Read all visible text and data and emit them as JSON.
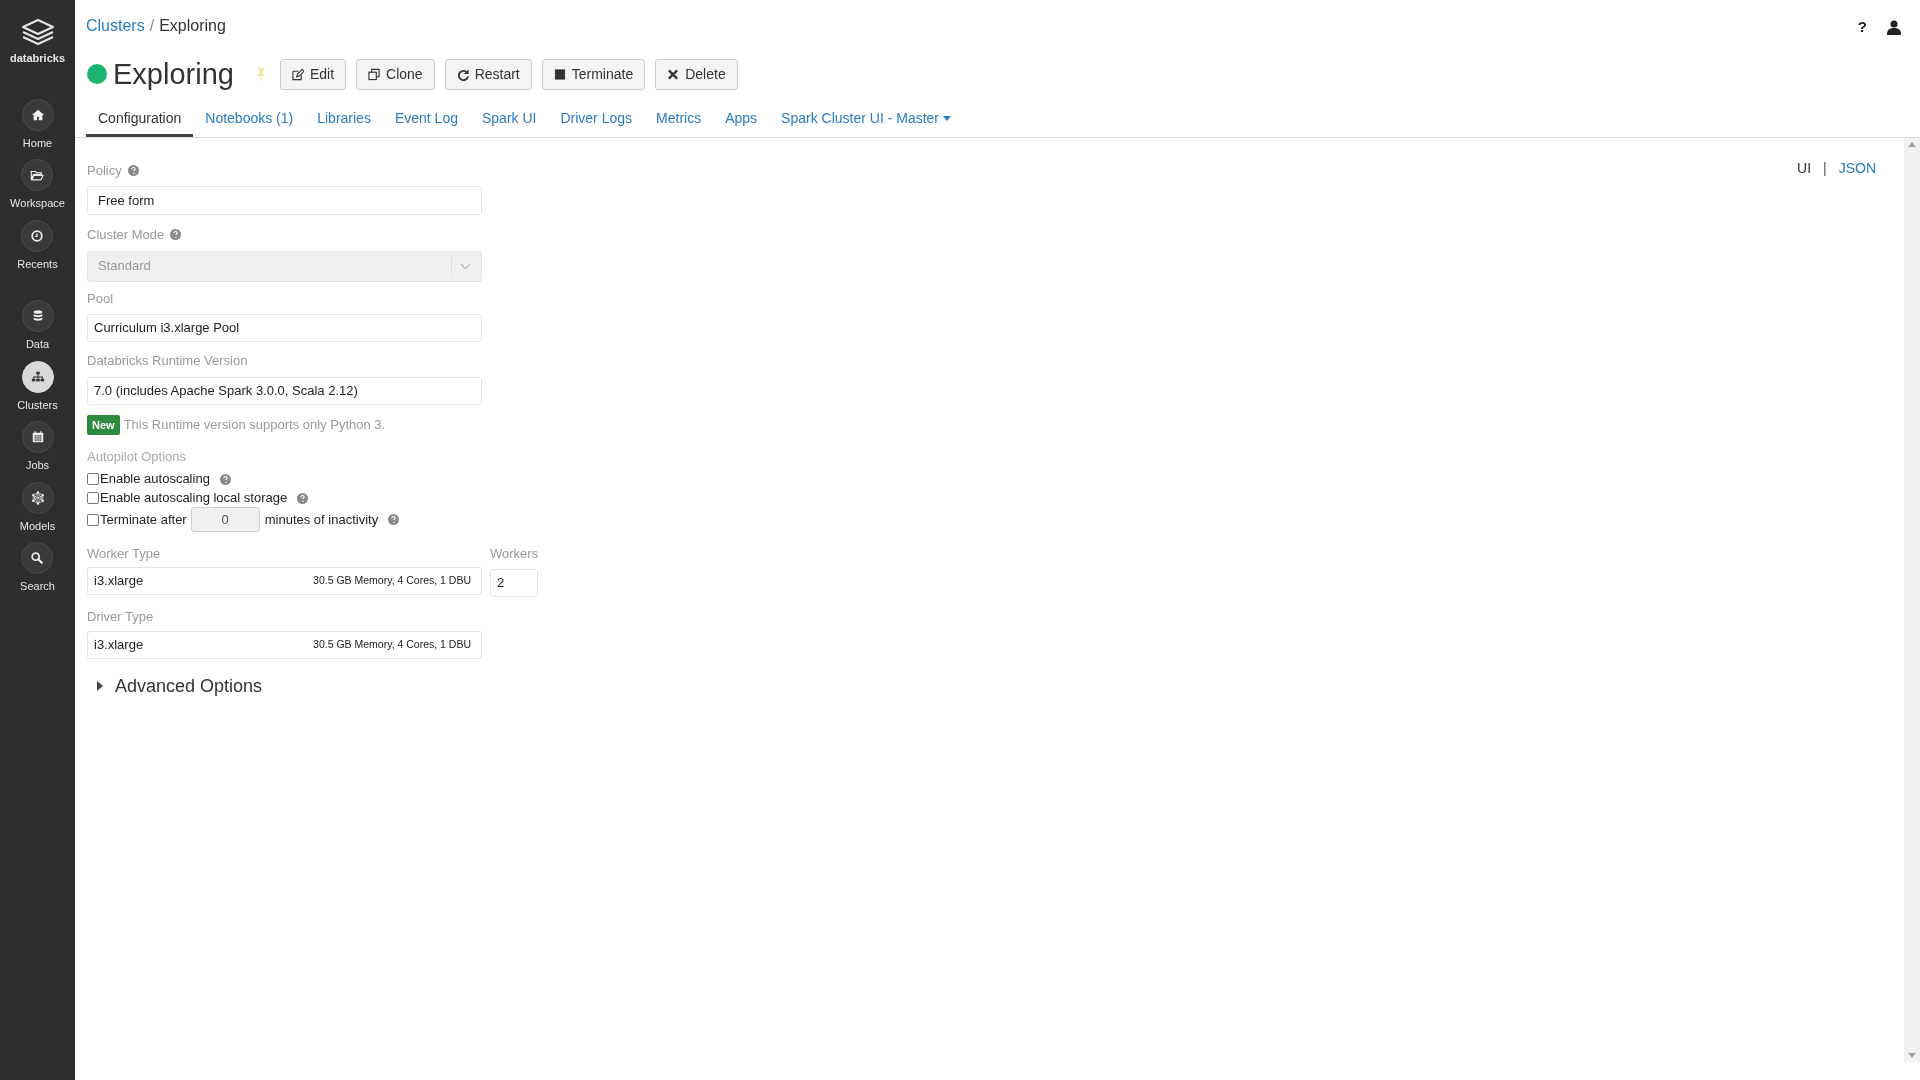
{
  "sidebar": {
    "logo_label": "databricks",
    "items": [
      {
        "label": "Home",
        "selected": false
      },
      {
        "label": "Workspace",
        "selected": false
      },
      {
        "label": "Recents",
        "selected": false
      },
      {
        "label": "Data",
        "selected": false
      },
      {
        "label": "Clusters",
        "selected": true
      },
      {
        "label": "Jobs",
        "selected": false
      },
      {
        "label": "Models",
        "selected": false
      },
      {
        "label": "Search",
        "selected": false
      }
    ]
  },
  "breadcrumb": {
    "link": "Clusters",
    "separator": "/",
    "current": "Exploring"
  },
  "top_right": {
    "help_glyph": "?"
  },
  "cluster": {
    "name": "Exploring",
    "running": true,
    "pinned": false
  },
  "actions": [
    {
      "label": "Edit"
    },
    {
      "label": "Clone"
    },
    {
      "label": "Restart"
    },
    {
      "label": "Terminate"
    },
    {
      "label": "Delete"
    }
  ],
  "tabs": [
    {
      "label": "Configuration",
      "selected": true,
      "dropdown": false
    },
    {
      "label": "Notebooks (1)",
      "selected": false,
      "dropdown": false
    },
    {
      "label": "Libraries",
      "selected": false,
      "dropdown": false
    },
    {
      "label": "Event Log",
      "selected": false,
      "dropdown": false
    },
    {
      "label": "Spark UI",
      "selected": false,
      "dropdown": false
    },
    {
      "label": "Driver Logs",
      "selected": false,
      "dropdown": false
    },
    {
      "label": "Metrics",
      "selected": false,
      "dropdown": false
    },
    {
      "label": "Apps",
      "selected": false,
      "dropdown": false
    },
    {
      "label": "Spark Cluster UI - Master",
      "selected": false,
      "dropdown": true
    }
  ],
  "view_switch": {
    "options": [
      {
        "label": "UI",
        "selected": true
      },
      {
        "label": "JSON",
        "selected": false
      }
    ],
    "separator": "|"
  },
  "form": {
    "policy": {
      "label": "Policy",
      "help": true,
      "value": "Free form"
    },
    "cluster_mode": {
      "label": "Cluster Mode",
      "help": true,
      "value": "Standard",
      "disabled": true
    },
    "pool": {
      "label": "Pool",
      "value": "Curriculum i3.xlarge Pool"
    },
    "runtime": {
      "label": "Databricks Runtime Version",
      "value": "7.0 (includes Apache Spark 3.0.0, Scala 2.12)"
    },
    "runtime_note": {
      "badge": "New",
      "text": "This Runtime version supports only Python 3."
    },
    "autopilot": {
      "label": "Autopilot Options",
      "options": [
        {
          "kind": "checkbox",
          "label": "Enable autoscaling",
          "checked": false,
          "help": true
        },
        {
          "kind": "checkbox",
          "label": "Enable autoscaling local storage",
          "checked": false,
          "help": true
        },
        {
          "kind": "timeout",
          "label": "Terminate after",
          "checked": false,
          "minutes": "0",
          "suffix": "minutes of inactivity",
          "help": true
        }
      ]
    },
    "worker_type": {
      "label": "Worker Type",
      "value": "i3.xlarge",
      "spec": "30.5 GB Memory, 4 Cores, 1 DBU"
    },
    "workers": {
      "label": "Workers",
      "value": "2"
    },
    "driver_type": {
      "label": "Driver Type",
      "value": "i3.xlarge",
      "spec": "30.5 GB Memory, 4 Cores, 1 DBU"
    },
    "advanced": {
      "label": "Advanced Options",
      "expanded": false
    }
  }
}
